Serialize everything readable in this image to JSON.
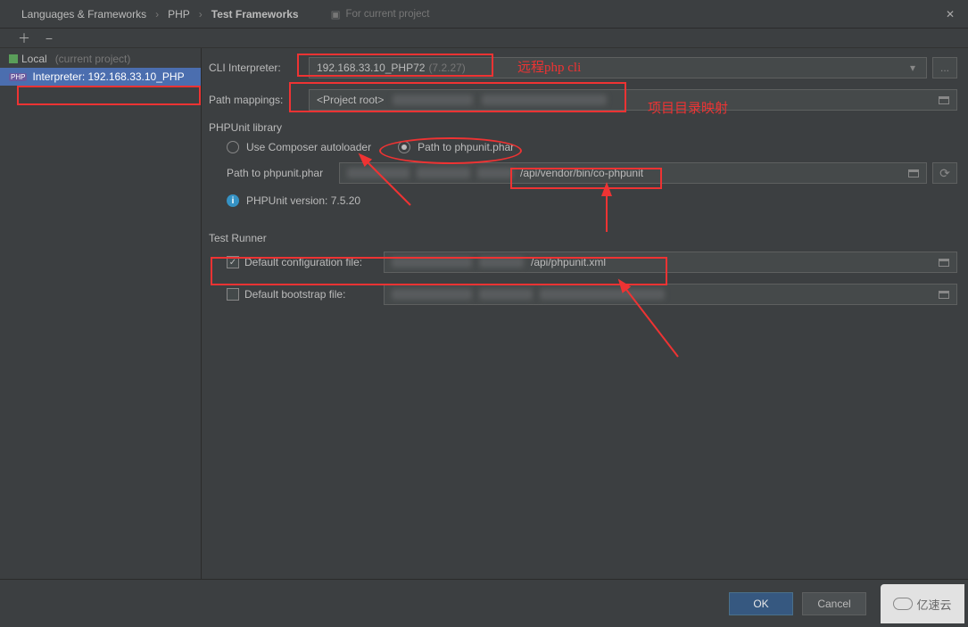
{
  "breadcrumb": {
    "level1": "Languages & Frameworks",
    "level2": "PHP",
    "level3": "Test Frameworks",
    "scope_label": "For current project"
  },
  "sidebar": {
    "local_label": "Local",
    "local_sub": "(current project)",
    "interpreter_label": "Interpreter: 192.168.33.10_PHP"
  },
  "cli_interpreter": {
    "label": "CLI Interpreter:",
    "value": "192.168.33.10_PHP72",
    "version": "(7.2.27)"
  },
  "path_mappings": {
    "label": "Path mappings:",
    "value": "<Project root>"
  },
  "phpunit_library": {
    "section": "PHPUnit library",
    "radio_composer": "Use Composer autoloader",
    "radio_phar": "Path to phpunit.phar",
    "path_label": "Path to phpunit.phar",
    "path_value_suffix": "/api/vendor/bin/co-phpunit",
    "version_label": "PHPUnit version: 7.5.20"
  },
  "test_runner": {
    "section": "Test Runner",
    "default_config_label": "Default configuration file:",
    "default_config_suffix": "/api/phpunit.xml",
    "default_bootstrap_label": "Default bootstrap file:"
  },
  "buttons": {
    "ok": "OK",
    "cancel": "Cancel",
    "more": "..."
  },
  "annotations": {
    "remote_php_cli": "远程php cli",
    "project_mapping": "项目目录映射"
  },
  "watermark": "亿速云"
}
